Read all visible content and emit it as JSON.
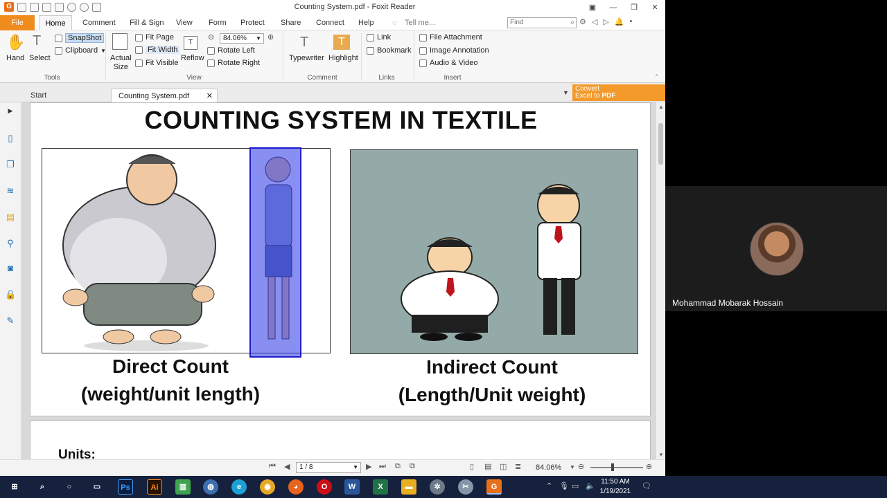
{
  "window": {
    "title": "Counting System.pdf - Foxit Reader"
  },
  "menu": {
    "tabs": [
      "File",
      "Home",
      "Comment",
      "Fill & Sign",
      "View",
      "Form",
      "Protect",
      "Share",
      "Connect",
      "Help"
    ],
    "tell_me": "Tell me...",
    "find_placeholder": "Find"
  },
  "ribbon": {
    "hand": "Hand",
    "select": "Select",
    "snapshot": "SnapShot",
    "clipboard": "Clipboard",
    "actual_size_1": "Actual",
    "actual_size_2": "Size",
    "fit_page": "Fit Page",
    "fit_width": "Fit Width",
    "fit_visible": "Fit Visible",
    "reflow": "Reflow",
    "zoom_value": "84.06%",
    "rotate_left": "Rotate Left",
    "rotate_right": "Rotate Right",
    "typewriter": "Typewriter",
    "highlight": "Highlight",
    "link": "Link",
    "bookmark": "Bookmark",
    "file_attachment": "File Attachment",
    "image_annotation": "Image Annotation",
    "audio_video": "Audio & Video",
    "groups": {
      "tools": "Tools",
      "view": "View",
      "comment": "Comment",
      "links": "Links",
      "insert": "Insert"
    }
  },
  "tabs": {
    "start": "Start",
    "active": "Counting System.pdf",
    "convert_line1": "Convert",
    "convert_line2a": "Excel to ",
    "convert_line2b": "PDF"
  },
  "document": {
    "title": "COUNTING SYSTEM IN TEXTILE",
    "left_caption_1": "Direct Count",
    "left_caption_2": "(weight/unit length)",
    "right_caption_1": "Indirect Count",
    "right_caption_2": "(Length/Unit weight)",
    "next_page_heading": "Units:"
  },
  "status": {
    "page": "1 / 8",
    "zoom": "84.06%"
  },
  "meeting": {
    "participant_name": "Mohammad Mobarak Hossain"
  },
  "taskbar": {
    "time": "11:50 AM",
    "date": "1/19/2021"
  }
}
